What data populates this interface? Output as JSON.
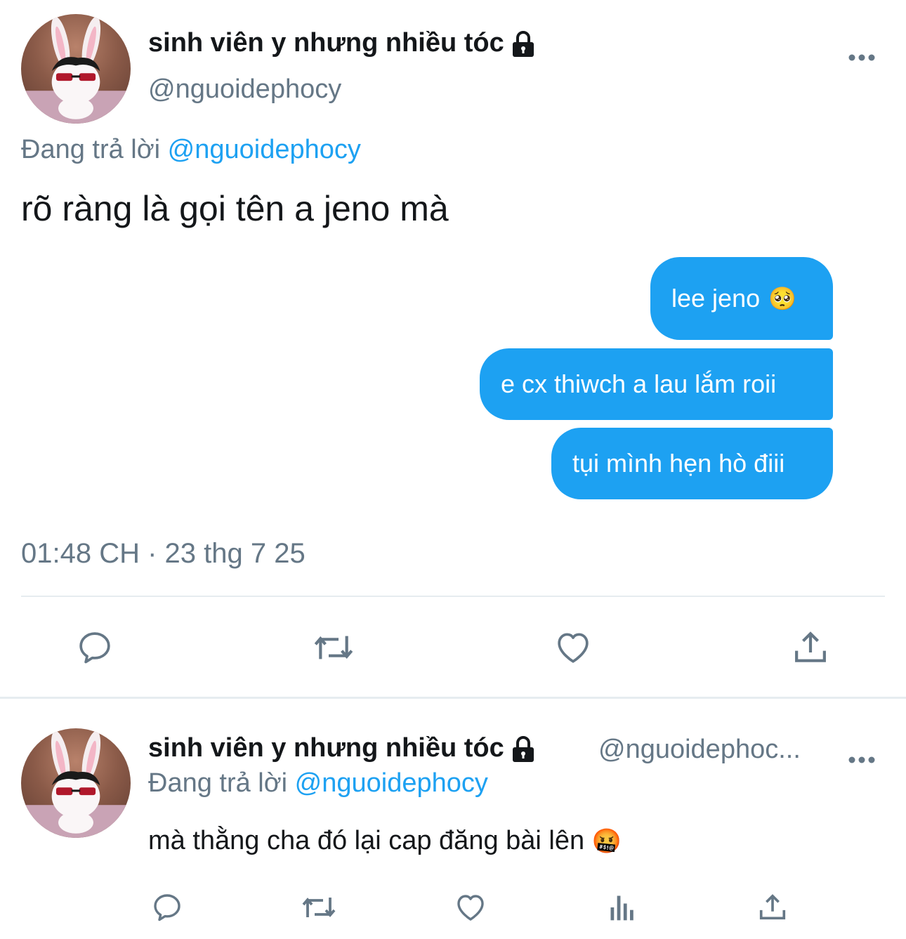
{
  "main_tweet": {
    "display_name": "sinh viên y nhưng nhiều tóc",
    "handle": "@nguoidephocy",
    "replying_prefix": "Đang trả lời",
    "replying_mention": "@nguoidephocy",
    "text": "rõ ràng là gọi tên a jeno mà",
    "bubbles": [
      {
        "text": "lee jeno",
        "emoji": "🥺"
      },
      {
        "text": "e cx thiwch a lau lắm roii"
      },
      {
        "text": "tụi mình hẹn hò điii"
      }
    ],
    "timestamp": "01:48 CH · 23 thg 7 25",
    "actions": [
      "reply-icon",
      "retweet-icon",
      "like-icon",
      "share-icon"
    ]
  },
  "reply_tweet": {
    "display_name": "sinh viên y nhưng nhiều tóc",
    "handle": "@nguoidephoc...",
    "replying_prefix": "Đang trả lời",
    "replying_mention": "@nguoidephocy",
    "text": "mà thằng cha đó lại cap đăng bài lên",
    "emoji": "🤬",
    "actions": [
      "reply-icon",
      "retweet-icon",
      "like-icon",
      "analytics-icon",
      "share-icon"
    ]
  },
  "colors": {
    "accent": "#1da1f2",
    "secondary_text": "#657786",
    "divider": "#e6ecf0"
  }
}
